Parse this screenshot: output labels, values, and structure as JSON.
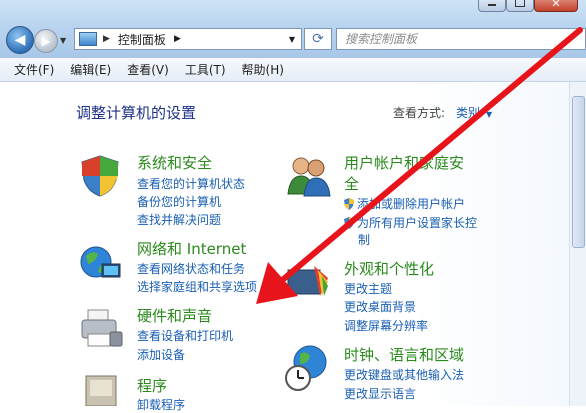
{
  "window": {
    "address_crumb": "控制面板",
    "search_placeholder": "搜索控制面板"
  },
  "menu": [
    "文件(F)",
    "编辑(E)",
    "查看(V)",
    "工具(T)",
    "帮助(H)"
  ],
  "content": {
    "heading": "调整计算机的设置",
    "view_by_label": "查看方式:",
    "view_by_value": "类别"
  },
  "categories": {
    "system_security": {
      "title": "系统和安全",
      "links": [
        "查看您的计算机状态",
        "备份您的计算机",
        "查找并解决问题"
      ]
    },
    "network": {
      "title": "网络和 Internet",
      "links": [
        "查看网络状态和任务",
        "选择家庭组和共享选项"
      ]
    },
    "hardware": {
      "title": "硬件和声音",
      "links": [
        "查看设备和打印机",
        "添加设备"
      ]
    },
    "programs": {
      "title": "程序",
      "links": [
        "卸载程序"
      ]
    },
    "user_accounts": {
      "title_line1": "用户帐户和家庭安",
      "title_line2": "全",
      "links": [
        "添加或删除用户帐户",
        "为所有用户设置家长控",
        "制"
      ]
    },
    "appearance": {
      "title": "外观和个性化",
      "links": [
        "更改主题",
        "更改桌面背景",
        "调整屏幕分辨率"
      ]
    },
    "clock": {
      "title": "时钟、语言和区域",
      "links": [
        "更改键盘或其他输入法",
        "更改显示语言"
      ]
    }
  },
  "colors": {
    "category_title": "#2a8a1c",
    "link": "#1a5fb4",
    "heading": "#1e3287",
    "annotation_arrow": "#e8141c"
  }
}
